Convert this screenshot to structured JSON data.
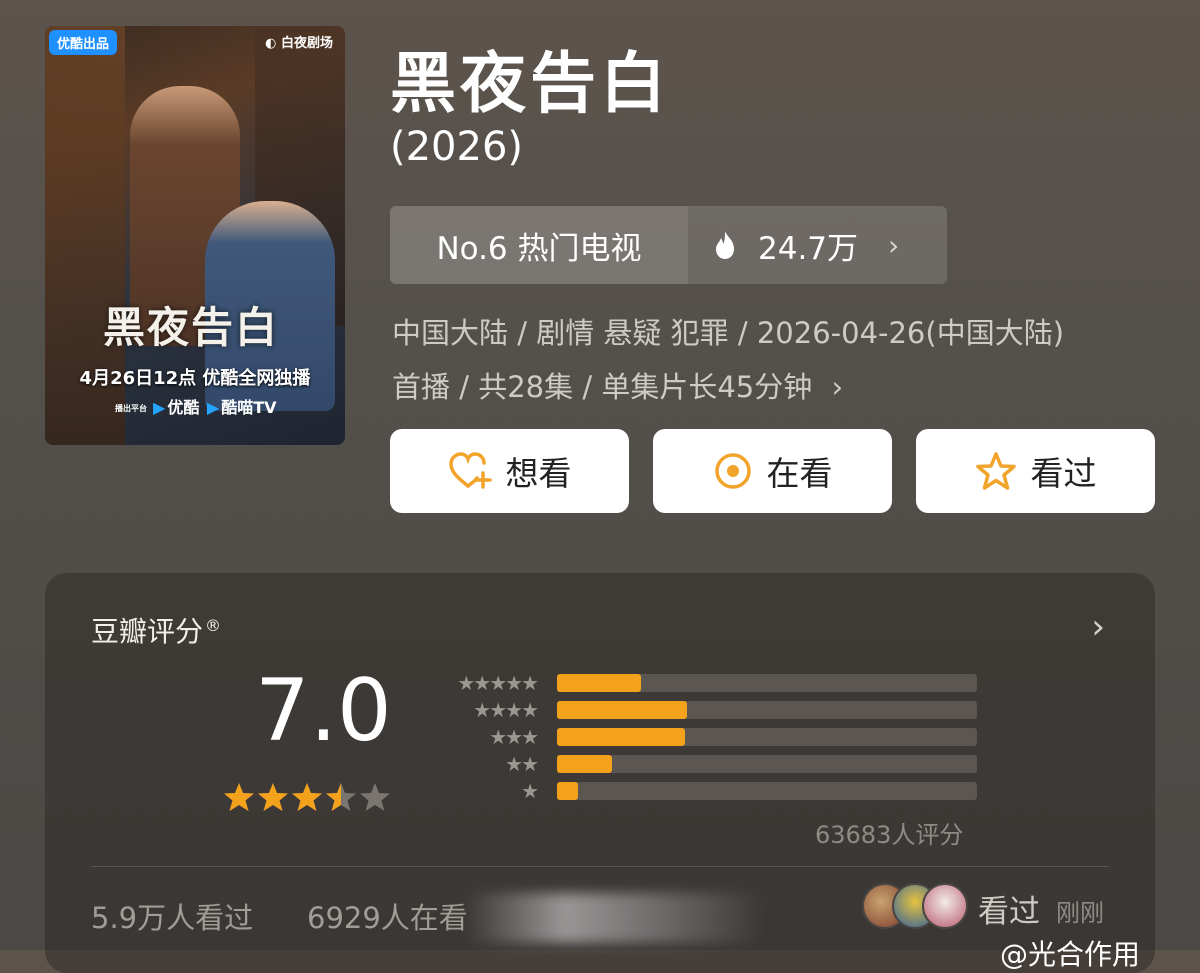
{
  "poster": {
    "tag": "优酷出品",
    "brand": "白夜剧场",
    "calligraphy_title": "黑夜告白",
    "airdate": "4月26日12点 优酷全网独播",
    "platform_prefix": "播出平台",
    "platform_1": "优酷",
    "platform_2": "酷喵TV"
  },
  "header": {
    "title": "黑夜告白",
    "year": "(2026)"
  },
  "rank": {
    "label": "No.6 热门电视",
    "heat": "24.7万"
  },
  "meta": {
    "line1": "中国大陆 / 剧情 悬疑 犯罪 / 2026-04-26(中国大陆)",
    "line2": "首播 / 共28集 / 单集片长45分钟"
  },
  "actions": {
    "want": "想看",
    "watching": "在看",
    "watched": "看过"
  },
  "rating": {
    "title": "豆瓣评分",
    "reg_mark": "®",
    "score": "7.0",
    "stars_value": 3.5,
    "stars_max": 5,
    "count": "63683人评分",
    "distribution": [
      {
        "stars": 5,
        "fraction": 0.2
      },
      {
        "stars": 4,
        "fraction": 0.31
      },
      {
        "stars": 3,
        "fraction": 0.305
      },
      {
        "stars": 2,
        "fraction": 0.13
      },
      {
        "stars": 1,
        "fraction": 0.05
      }
    ]
  },
  "stats": {
    "watched": "5.9万人看过",
    "watching": "6929人在看"
  },
  "friends": {
    "label": "看过",
    "time": "刚刚"
  },
  "watermark": "@光合作用",
  "colors": {
    "accent": "#f4a21b",
    "icon_orange": "#f2a32a"
  },
  "icons": {
    "heat": "flame-icon",
    "want": "heart-plus-icon",
    "watching": "target-icon",
    "watched": "star-outline-icon"
  }
}
